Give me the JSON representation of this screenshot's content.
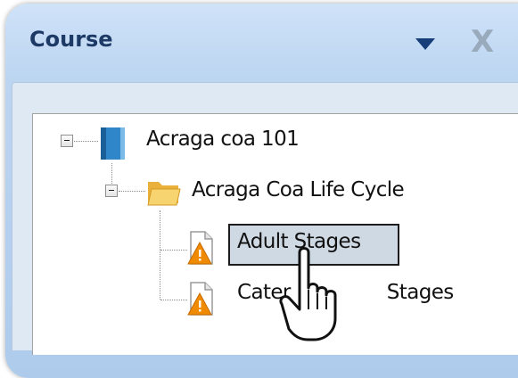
{
  "panel": {
    "title": "Course",
    "dropdown_icon": "chevron-down-icon",
    "close_icon": "close-icon",
    "close_label": "X"
  },
  "tree": {
    "root": {
      "label": "Acraga coa 101",
      "icon": "book-icon",
      "expanded": true
    },
    "folder": {
      "label": "Acraga Coa Life Cycle",
      "icon": "folder-icon",
      "expanded": true
    },
    "items": [
      {
        "label": "Adult Stages",
        "icon": "warning-document-icon",
        "selected": true
      },
      {
        "label": "Caterpillar Stages",
        "label_visible_left": "Cater",
        "label_visible_right": "Stages",
        "icon": "warning-document-icon",
        "selected": false
      }
    ]
  },
  "cursor": {
    "icon": "hand-pointer-icon"
  },
  "colors": {
    "title": "#1d3a66",
    "panel_background": "#bcd5f1",
    "selection_background": "#cfd9e3",
    "warning": "#f08a00"
  }
}
